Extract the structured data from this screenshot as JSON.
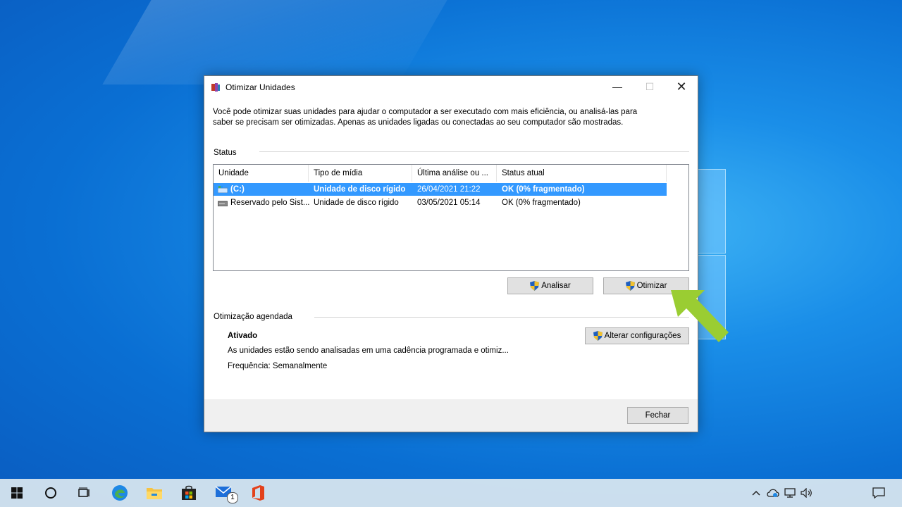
{
  "window": {
    "title": "Otimizar Unidades",
    "minimize_glyph": "—",
    "maximize_glyph": "☐",
    "close_glyph": "✕"
  },
  "intro": {
    "line1": "Você pode otimizar suas unidades para ajudar o computador a ser executado com mais eficiência, ou analisá-las para",
    "line2": "saber se precisam ser otimizadas. Apenas as unidades ligadas ou conectadas ao seu computador são mostradas."
  },
  "status": {
    "label": "Status",
    "columns": [
      "Unidade",
      "Tipo de mídia",
      "Última análise ou ...",
      "Status atual"
    ],
    "rows": [
      {
        "drive": "(C:)",
        "media": "Unidade de disco rígido",
        "last": "26/04/2021 21:22",
        "state": "OK (0% fragmentado)",
        "selected": true
      },
      {
        "drive": "Reservado pelo Sist...",
        "media": "Unidade de disco rígido",
        "last": "03/05/2021 05:14",
        "state": "OK (0% fragmentado)",
        "selected": false
      }
    ],
    "analyze_label": "Analisar",
    "optimize_label": "Otimizar"
  },
  "schedule": {
    "label": "Otimização agendada",
    "state": "Ativado",
    "description": "As unidades estão sendo analisadas em uma cadência programada e otimiz...",
    "frequency": "Frequência: Semanalmente",
    "change_label": "Alterar configurações"
  },
  "footer": {
    "close_label": "Fechar"
  },
  "taskbar": {
    "mail_badge": "1",
    "apps": [
      "start-icon",
      "search-icon",
      "task-view-icon",
      "edge-icon",
      "file-explorer-icon",
      "store-icon",
      "mail-icon",
      "office-icon"
    ]
  },
  "colors": {
    "selection": "#3399ff",
    "arrow": "#9acd32",
    "accent": "#0078d7"
  }
}
